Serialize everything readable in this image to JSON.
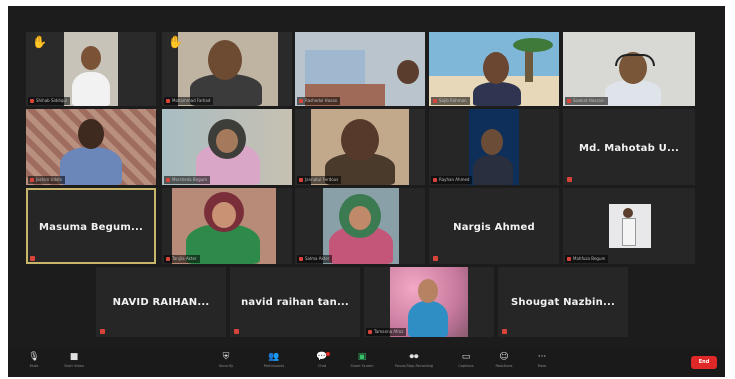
{
  "tiles": {
    "t1": {
      "caption": "Shihab Siddiqui",
      "hand": "✋"
    },
    "t2": {
      "caption": "Mohammad Farhad",
      "hand": "✋"
    },
    "t3": {
      "caption": "Rashedul Hasan"
    },
    "t4": {
      "caption": "Sajib Rahman"
    },
    "t5": {
      "caption": "Sowkat Hossain"
    },
    "t6": {
      "caption": "Joshim Uddin"
    },
    "t7": {
      "caption": "Morsheda Begum"
    },
    "t8": {
      "caption": "Jannatul Ferdous"
    },
    "t9": {
      "caption": "Rayhan Ahmed"
    },
    "t10": {
      "name": "Md. Mahotab U..."
    },
    "t11": {
      "name": "Masuma Begum..."
    },
    "t12": {
      "caption": "Tanjila Akter"
    },
    "t13": {
      "caption": "Salma Akter"
    },
    "t14": {
      "name": "Nargis Ahmed"
    },
    "t15": {
      "caption": "Mahfuza Begum"
    },
    "t16": {
      "name": "NAVID RAIHAN..."
    },
    "t17": {
      "name": "navid raihan tan..."
    },
    "t18": {
      "caption": "Tamanna Afroz"
    },
    "t19": {
      "name": "Shougat Nazbin..."
    }
  },
  "toolbar": {
    "mute": {
      "icon": "🎙",
      "label": "Mute"
    },
    "video": {
      "icon": "■",
      "label": "Start Video"
    },
    "security": {
      "icon": "⛨",
      "label": "Security"
    },
    "participants": {
      "icon": "👥",
      "label": "Participants",
      "count": "24"
    },
    "chat": {
      "icon": "💬",
      "label": "Chat"
    },
    "share": {
      "icon": "▣",
      "label": "Share Screen"
    },
    "record": {
      "icon": "⏺⏺",
      "label": "Pause/Stop Recording"
    },
    "captions": {
      "icon": "▭",
      "label": "Captions"
    },
    "reactions": {
      "icon": "☺",
      "label": "Reactions"
    },
    "more": {
      "icon": "···",
      "label": "More"
    },
    "end": {
      "label": "End"
    }
  },
  "colors": {
    "accent_green": "#35c06a",
    "end_red": "#e02828",
    "speaker_outline": "#c9b66b"
  }
}
